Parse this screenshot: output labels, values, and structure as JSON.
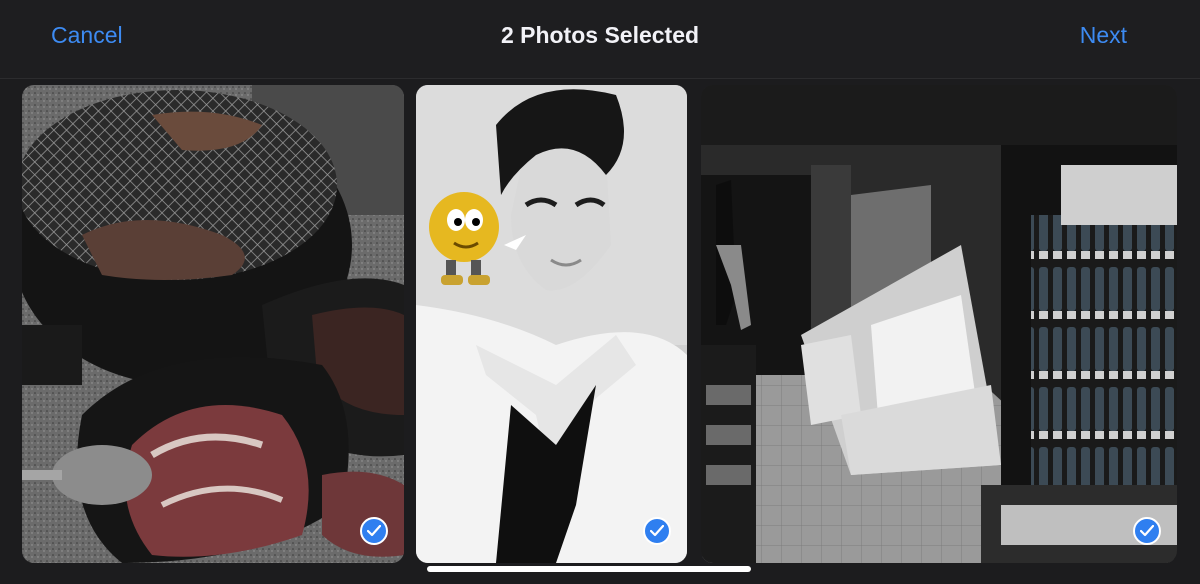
{
  "navbar": {
    "cancel_label": "Cancel",
    "title": "2 Photos Selected",
    "next_label": "Next"
  },
  "photos": [
    {
      "subject": "grilled-meat-photo",
      "selected": true,
      "check_icon": "checkmark-icon"
    },
    {
      "subject": "portrait-photo",
      "selected": true,
      "check_icon": "checkmark-icon"
    },
    {
      "subject": "store-aisle-photo",
      "selected": true,
      "check_icon": "checkmark-icon"
    }
  ],
  "colors": {
    "accent": "#3d8bf2",
    "background": "#1c1c1e",
    "check_fill": "#2f7ff0"
  }
}
